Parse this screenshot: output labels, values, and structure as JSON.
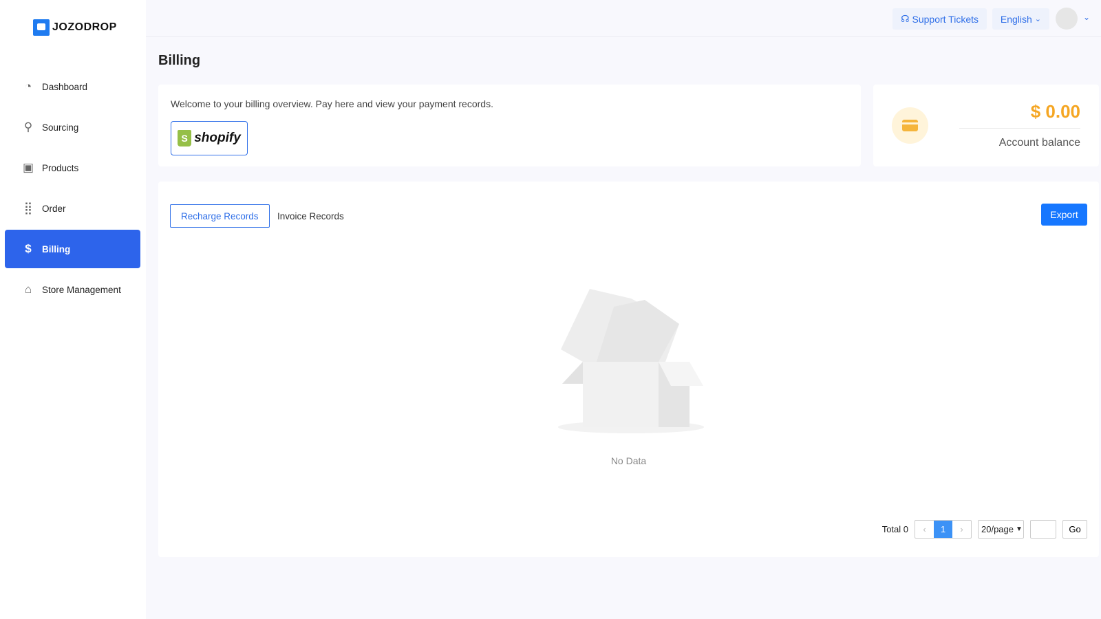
{
  "brand": {
    "name": "JOZODROP"
  },
  "sidebar": {
    "items": [
      {
        "label": "Dashboard",
        "icon": "gauge-icon"
      },
      {
        "label": "Sourcing",
        "icon": "search-heart-icon"
      },
      {
        "label": "Products",
        "icon": "box-icon"
      },
      {
        "label": "Order",
        "icon": "grid-icon"
      },
      {
        "label": "Billing",
        "icon": "coins-icon",
        "active": true
      },
      {
        "label": "Store Management",
        "icon": "store-icon"
      }
    ]
  },
  "header": {
    "support": "Support Tickets",
    "language": "English"
  },
  "page": {
    "title": "Billing"
  },
  "overview": {
    "welcome": "Welcome to your billing overview. Pay here and view your payment records.",
    "shopify": "shopify"
  },
  "balance": {
    "amount": "$ 0.00",
    "label": "Account balance",
    "color": "#f5a623"
  },
  "records": {
    "tabs": [
      "Recharge Records",
      "Invoice Records"
    ],
    "active_tab": 0,
    "export": "Export",
    "empty": "No Data"
  },
  "pagination": {
    "total": "Total 0",
    "prev": "‹",
    "current": "1",
    "next": "›",
    "page_size": "20/page",
    "go": "Go"
  },
  "colors": {
    "accent": "#2d64eb",
    "button": "#1677ff"
  }
}
